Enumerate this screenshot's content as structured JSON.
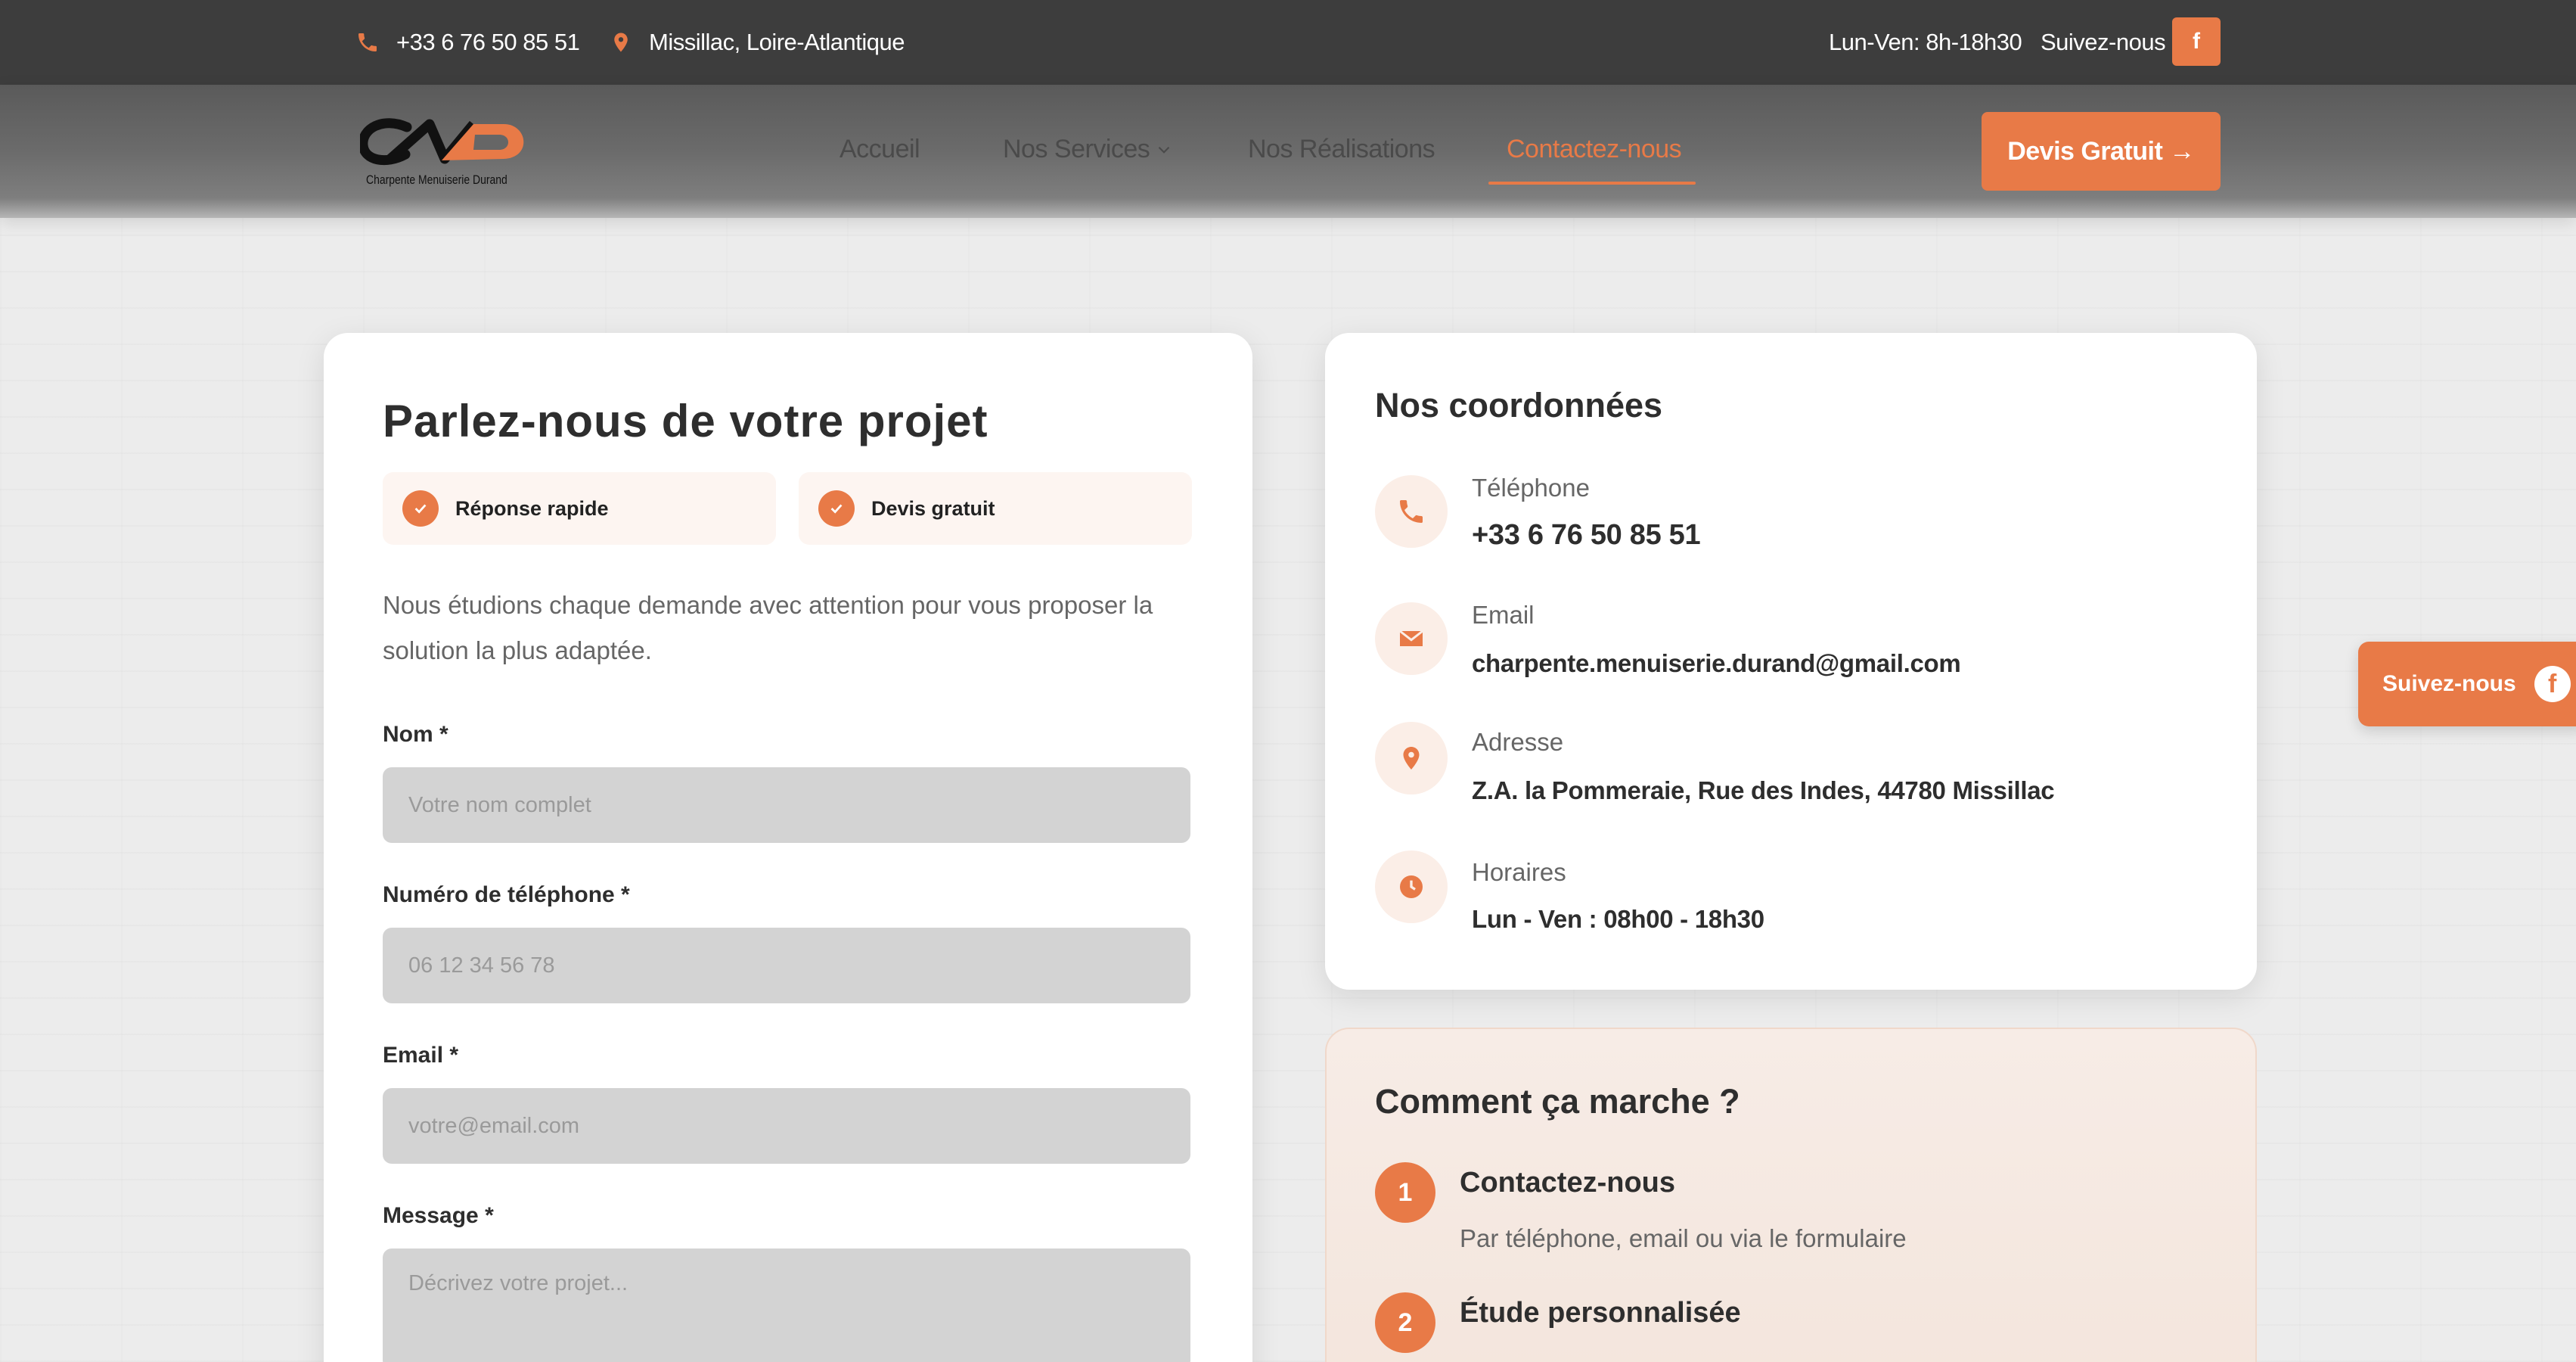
{
  "topbar": {
    "phone": "+33 6 76 50 85 51",
    "location": "Missillac, Loire-Atlantique",
    "hours": "Lun-Ven: 8h-18h30",
    "follow": "Suivez-nous",
    "fb_letter": "f"
  },
  "nav": {
    "logo_text": "Charpente Menuiserie Durand",
    "links": [
      "Accueil",
      "Nos Services",
      "Nos Réalisations",
      "Contactez-nous"
    ],
    "active_link": "Contactez-nous",
    "cta": "Devis Gratuit →"
  },
  "form": {
    "title": "Parlez-nous de votre projet",
    "badges": [
      "Réponse rapide",
      "Devis gratuit"
    ],
    "intro": "Nous étudions chaque demande avec attention pour vous proposer la solution la plus adaptée.",
    "fields": [
      {
        "label": "Nom *",
        "placeholder": "Votre nom complet"
      },
      {
        "label": "Numéro de téléphone *",
        "placeholder": "06 12 34 56 78"
      },
      {
        "label": "Email *",
        "placeholder": "votre@email.com"
      },
      {
        "label": "Message *",
        "placeholder": "Décrivez votre projet..."
      }
    ]
  },
  "coords": {
    "title": "Nos coordonnées",
    "items": [
      {
        "label": "Téléphone",
        "value": "+33 6 76 50 85 51",
        "icon": "phone-icon"
      },
      {
        "label": "Email",
        "value": "charpente.menuiserie.durand@gmail.com",
        "icon": "envelope-icon"
      },
      {
        "label": "Adresse",
        "value": "Z.A. la Pommeraie, Rue des Indes, 44780 Missillac",
        "icon": "map-pin-icon"
      },
      {
        "label": "Horaires",
        "value": "Lun - Ven : 08h00 - 18h30",
        "icon": "clock-icon"
      }
    ]
  },
  "how": {
    "title": "Comment ça marche ?",
    "steps": [
      {
        "num": "1",
        "title": "Contactez-nous",
        "desc": "Par téléphone, email ou via le formulaire"
      },
      {
        "num": "2",
        "title": "Étude personnalisée",
        "desc": ""
      }
    ]
  },
  "floating": {
    "label": "Suivez-nous",
    "icon_letter": "f"
  },
  "colors": {
    "accent": "#e87a47",
    "topbar": "#3d3d3d",
    "card": "#ffffff"
  }
}
